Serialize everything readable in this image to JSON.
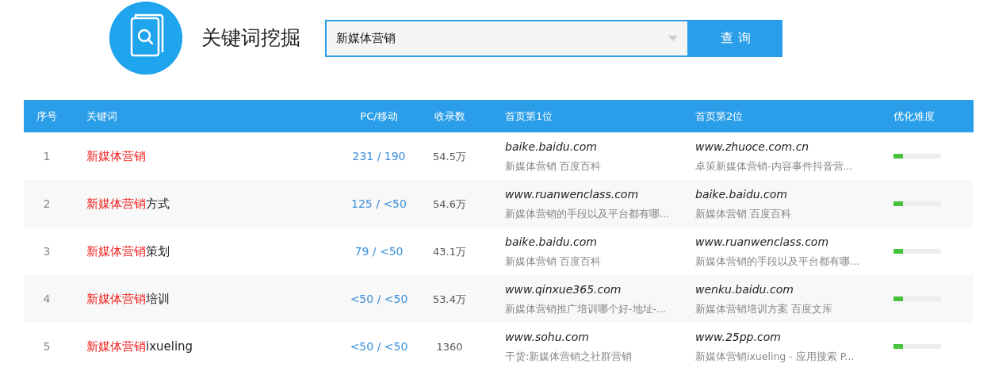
{
  "header": {
    "title": "关键词挖掘",
    "search": {
      "value": "新媒体营销"
    },
    "button": "查 询"
  },
  "table": {
    "columns": [
      "序号",
      "关键词",
      "PC/移动",
      "收录数",
      "首页第1位",
      "首页第2位",
      "优化难度"
    ],
    "rows": [
      {
        "index": "1",
        "keyword": {
          "match": "新媒体营销"
        },
        "pc_mobile": "231 / 190",
        "indexed": "54.5万",
        "first": {
          "domain": "baike.baidu.com",
          "title": "新媒体营销 百度百科"
        },
        "second": {
          "domain": "www.zhuoce.com.cn",
          "title": "卓策新媒体营销-内容事件抖音营..."
        },
        "difficulty": {
          "level": 0.2
        }
      },
      {
        "index": "2",
        "keyword": {
          "match": "新媒体营销",
          "suffix": "方式"
        },
        "pc_mobile": "125 / <50",
        "indexed": "54.6万",
        "first": {
          "domain": "www.ruanwenclass.com",
          "title": "新媒体营销的手段以及平台都有哪..."
        },
        "second": {
          "domain": "baike.baidu.com",
          "title": "新媒体营销 百度百科"
        },
        "difficulty": {
          "level": 0.2
        }
      },
      {
        "index": "3",
        "keyword": {
          "match": "新媒体营销",
          "suffix": "策划"
        },
        "pc_mobile": "79 / <50",
        "indexed": "43.1万",
        "first": {
          "domain": "baike.baidu.com",
          "title": "新媒体营销 百度百科"
        },
        "second": {
          "domain": "www.ruanwenclass.com",
          "title": "新媒体营销的手段以及平台都有哪..."
        },
        "difficulty": {
          "level": 0.2
        }
      },
      {
        "index": "4",
        "keyword": {
          "match": "新媒体营销",
          "suffix": "培训"
        },
        "pc_mobile": "<50 / <50",
        "indexed": "53.4万",
        "first": {
          "domain": "www.qinxue365.com",
          "title": "新媒体营销推广培训哪个好-地址-..."
        },
        "second": {
          "domain": "wenku.baidu.com",
          "title": "新媒体营销培训方案 百度文库"
        },
        "difficulty": {
          "level": 0.2
        }
      },
      {
        "index": "5",
        "keyword": {
          "match": "新媒体营销",
          "suffix": "ixueling"
        },
        "pc_mobile": "<50 / <50",
        "indexed": "1360",
        "first": {
          "domain": "www.sohu.com",
          "title": "干货:新媒体营销之社群营销"
        },
        "second": {
          "domain": "www.25pp.com",
          "title": "新媒体营销ixueling - 应用搜索 P..."
        },
        "difficulty": {
          "level": 0.2
        }
      }
    ]
  }
}
